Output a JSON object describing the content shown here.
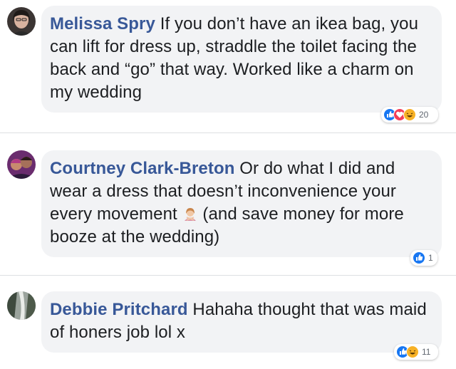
{
  "comments": [
    {
      "author": "Melissa Spry",
      "text": " If you don’t have an ikea bag, you can lift for dress up, straddle the toilet facing the back and “go” that way. Worked like a charm on my wedding",
      "reaction_count": "20",
      "reactions": [
        "like-icon",
        "love-icon",
        "haha-icon"
      ]
    },
    {
      "author": "Courtney Clark-Breton",
      "text_before": " Or do what I did and wear a dress that doesn’t inconvenience your every movement ",
      "text_after": " (and save money for more booze at the wedding)",
      "reaction_count": "1",
      "reactions": [
        "like-icon"
      ]
    },
    {
      "author": "Debbie Pritchard",
      "text": " Hahaha thought that was maid of honers job lol x",
      "reaction_count": "11",
      "reactions": [
        "like-icon",
        "haha-icon"
      ]
    }
  ],
  "colors": {
    "author": "#385898",
    "bubble": "#f2f3f5",
    "like": "#1877f2",
    "love": "#f33e58",
    "haha": "#f7b125"
  }
}
